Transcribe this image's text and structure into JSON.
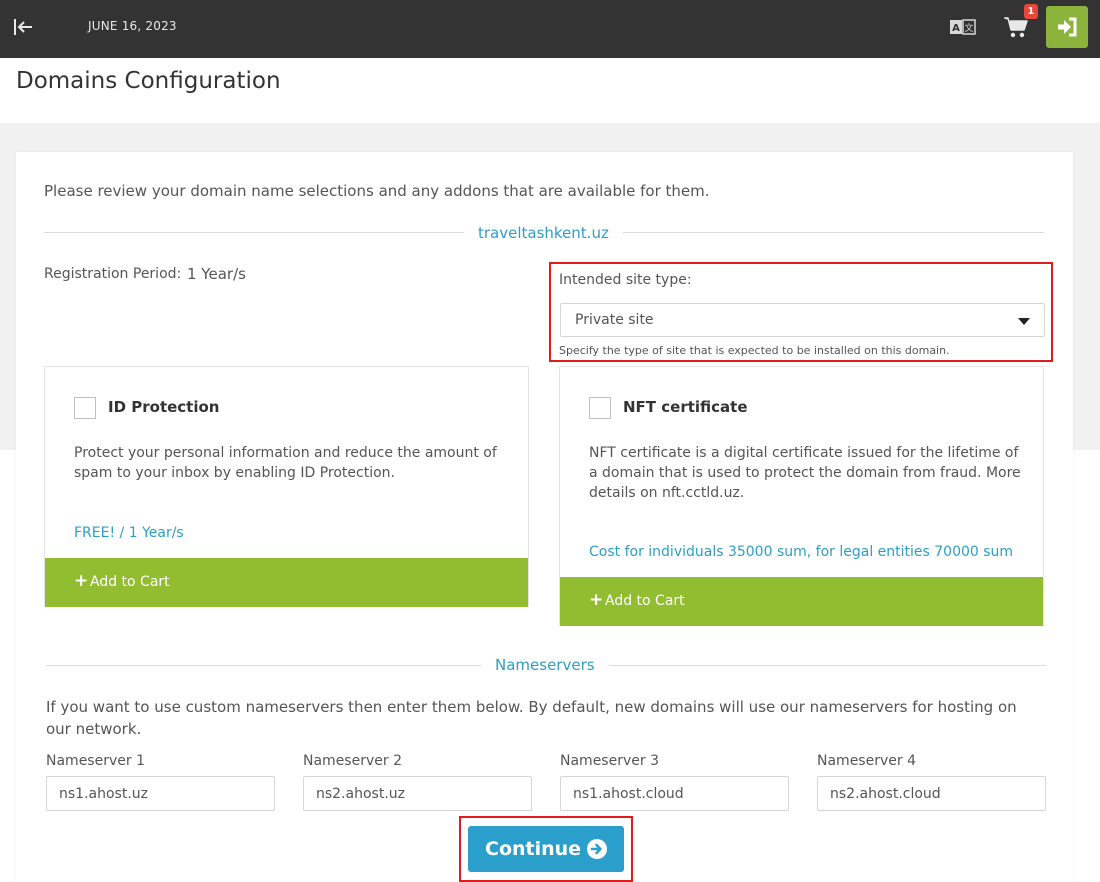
{
  "header": {
    "date": "JUNE 16, 2023",
    "cart_count": "1",
    "icons": [
      "collapse-sidebar-icon",
      "translate-icon",
      "cart-icon",
      "login-icon"
    ]
  },
  "page": {
    "title": "Domains Configuration"
  },
  "config": {
    "intro": "Please review your domain name selections and any addons that are available for them.",
    "domain_name": "traveltashkent.uz",
    "registration_period_label": "Registration Period:",
    "registration_period_value": "1 Year/s",
    "site_type_label": "Intended site type:",
    "site_type_value": "Private site",
    "site_type_help": "Specify the type of site that is expected to be installed on this domain."
  },
  "addons": [
    {
      "name": "ID Protection",
      "description": "Protect your personal information and reduce the amount of spam to your inbox by enabling ID Protection.",
      "price": "FREE! / 1 Year/s",
      "button": "Add to Cart"
    },
    {
      "name": "NFT certificate",
      "description": "NFT certificate is a digital certificate issued for the lifetime of a domain that is used to protect the domain from fraud. More details on nft.cctld.uz.",
      "price": "Cost for individuals 35000 sum, for legal entities 70000 sum",
      "button": "Add to Cart"
    }
  ],
  "nameservers": {
    "heading": "Nameservers",
    "intro": "If you want to use custom nameservers then enter them below. By default, new domains will use our nameservers for hosting on our network.",
    "fields": [
      {
        "label": "Nameserver 1",
        "value": "ns1.ahost.uz"
      },
      {
        "label": "Nameserver 2",
        "value": "ns2.ahost.uz"
      },
      {
        "label": "Nameserver 3",
        "value": "ns1.ahost.cloud"
      },
      {
        "label": "Nameserver 4",
        "value": "ns2.ahost.cloud"
      }
    ]
  },
  "actions": {
    "continue_label": "Continue"
  },
  "colors": {
    "topbar": "#333333",
    "accent_green": "#93bd31",
    "accent_blue": "#2b9fcb",
    "link_blue": "#2d9fc5",
    "highlight_red": "#e01b1b",
    "badge_red": "#e5473b"
  }
}
